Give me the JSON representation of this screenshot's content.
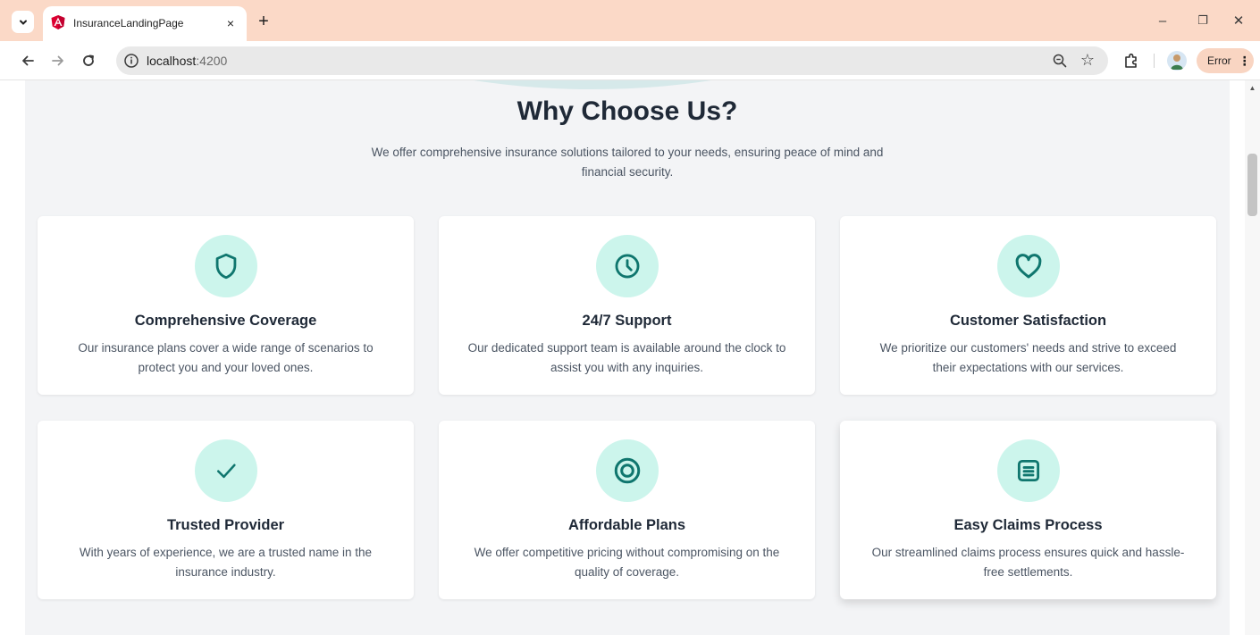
{
  "browser": {
    "tab_title": "InsuranceLandingPage",
    "tab_close": "×",
    "new_tab": "+",
    "url_host": "localhost",
    "url_port": ":4200",
    "error_label": "Error",
    "error_menu": "⋮",
    "minimize": "–",
    "restore": "❐",
    "close": "✕"
  },
  "section": {
    "title": "Why Choose Us?",
    "subtitle": "We offer comprehensive insurance solutions tailored to your needs, ensuring peace of mind and financial security."
  },
  "features": [
    {
      "icon": "shield-icon",
      "title": "Comprehensive Coverage",
      "description": "Our insurance plans cover a wide range of scenarios to protect you and your loved ones."
    },
    {
      "icon": "clock-icon",
      "title": "24/7 Support",
      "description": "Our dedicated support team is available around the clock to assist you with any inquiries."
    },
    {
      "icon": "heart-icon",
      "title": "Customer Satisfaction",
      "description": "We prioritize our customers' needs and strive to exceed their expectations with our services."
    },
    {
      "icon": "check-icon",
      "title": "Trusted Provider",
      "description": "With years of experience, we are a trusted name in the insurance industry."
    },
    {
      "icon": "target-icon",
      "title": "Affordable Plans",
      "description": "We offer competitive pricing without compromising on the quality of coverage."
    },
    {
      "icon": "document-icon",
      "title": "Easy Claims Process",
      "description": "Our streamlined claims process ensures quick and hassle-free settlements."
    }
  ],
  "colors": {
    "accent": "#0f766e",
    "icon_bg": "#ccf5ec",
    "tabbar": "#fbd9c7",
    "section_bg": "#f3f4f6"
  }
}
